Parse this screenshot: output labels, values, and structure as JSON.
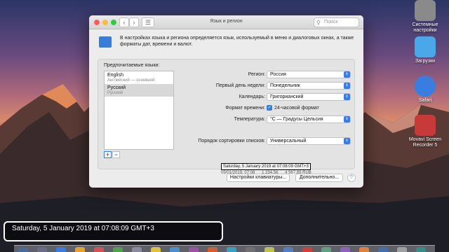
{
  "desktop": {
    "icons": [
      {
        "label": "Системные настройки",
        "color": "#8a8a8a"
      },
      {
        "label": "Загрузки",
        "color": "#4aa8e8"
      },
      {
        "label": "Safari",
        "color": "#3a7de0"
      },
      {
        "label": "Movavi Screen Recorder 5",
        "color": "#c83a3a"
      }
    ]
  },
  "window": {
    "title": "Язык и регион",
    "search_placeholder": "Поиск",
    "info": "В настройках языка и региона определяется язык, используемый в меню и диалоговых окнах, а также форматы дат, времени и валют.",
    "preferred_label": "Предпочитаемые языки:",
    "languages": [
      {
        "name": "English",
        "sub": "Английский — основной"
      },
      {
        "name": "Русский",
        "sub": "Русский"
      }
    ],
    "settings": {
      "region_label": "Регион:",
      "region_value": "Россия",
      "firstday_label": "Первый день недели:",
      "firstday_value": "Понедельник",
      "calendar_label": "Календарь:",
      "calendar_value": "Григорианский",
      "timefmt_label": "Формат времени:",
      "timefmt_value": "24-часовой формат",
      "temp_label": "Температура:",
      "temp_value": "°С — Градусы Цельсия",
      "sort_label": "Порядок сортировки списков:",
      "sort_value": "Универсальный"
    },
    "samples": {
      "date_long": "Saturday, 5 January 2019 at 07:08:09 GMT+3",
      "date_short": "05/01/2019, 07:08",
      "num": "1 234,56",
      "currency": "4 567,89 RUB"
    },
    "buttons": {
      "keyboard": "Настройки клавиатуры...",
      "advanced": "Дополнительно...",
      "help": "?"
    }
  },
  "caption": {
    "text": "Saturday, 5 January 2019 at 07:08:09 GMT+3"
  },
  "dock": {
    "colors": [
      "#4a6a9a",
      "#6a6a8a",
      "#3a7de0",
      "#e8a030",
      "#d85050",
      "#50a050",
      "#8a8aa0",
      "#e0c040",
      "#4a90d0",
      "#a050a0",
      "#d06030",
      "#3aa0c0",
      "#707070",
      "#c0c050",
      "#5080c0",
      "#d04040",
      "#60a080",
      "#9060c0",
      "#e08040",
      "#4070b0",
      "#a0a0a0",
      "#3a8a8a"
    ]
  }
}
